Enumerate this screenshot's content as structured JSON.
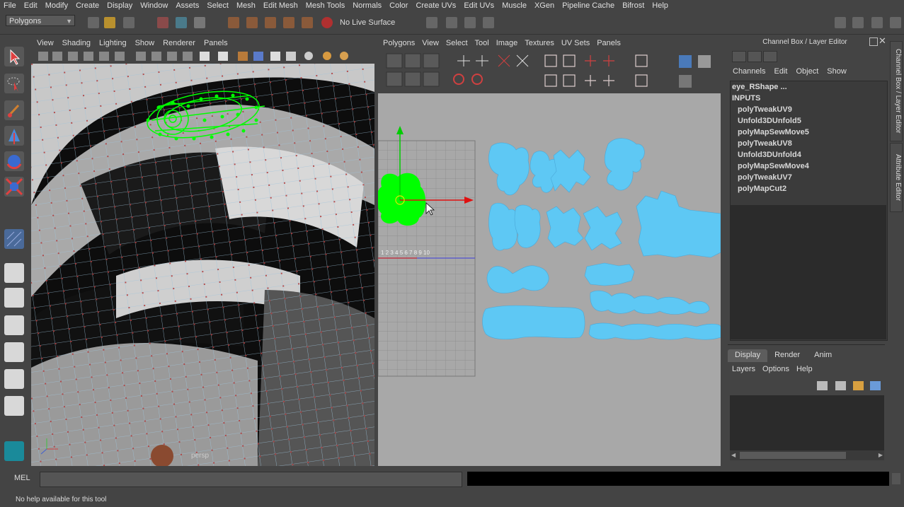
{
  "menubar": [
    "File",
    "Edit",
    "Modify",
    "Create",
    "Display",
    "Window",
    "Assets",
    "Select",
    "Mesh",
    "Edit Mesh",
    "Mesh Tools",
    "Normals",
    "Color",
    "Create UVs",
    "Edit UVs",
    "Muscle",
    "XGen",
    "Pipeline Cache",
    "Bifrost",
    "Help"
  ],
  "status_line": {
    "menu_set": "Polygons",
    "live_surface": "No Live Surface"
  },
  "viewport": {
    "menu": [
      "View",
      "Shading",
      "Lighting",
      "Show",
      "Renderer",
      "Panels"
    ],
    "camera_label": "persp"
  },
  "uv_editor": {
    "menu": [
      "Polygons",
      "View",
      "Select",
      "Tool",
      "Image",
      "Textures",
      "UV Sets",
      "Panels"
    ],
    "axis_numbers": "1 2 3 4 5 6 7 8 9 10"
  },
  "channel_box": {
    "title": "Channel Box / Layer Editor",
    "menu": [
      "Channels",
      "Edit",
      "Object",
      "Show"
    ],
    "object_name": "eye_RShape ...",
    "inputs_label": "INPUTS",
    "inputs": [
      "polyTweakUV9",
      "Unfold3DUnfold5",
      "polyMapSewMove5",
      "polyTweakUV8",
      "Unfold3DUnfold4",
      "polyMapSewMove4",
      "polyTweakUV7",
      "polyMapCut2"
    ]
  },
  "layer_editor": {
    "tabs": [
      "Display",
      "Render",
      "Anim"
    ],
    "active_tab": "Display",
    "menu": [
      "Layers",
      "Options",
      "Help"
    ]
  },
  "side_tabs": [
    "Channel Box / Layer Editor",
    "Attribute Editor"
  ],
  "command_line": {
    "label": "MEL",
    "value": ""
  },
  "help_line": "No help available for this tool",
  "colors": {
    "uv_shell": "#5ec8f4",
    "selection": "#00ff00",
    "uv_bg": "#a8a8a8",
    "manip_x": "#e01010"
  }
}
